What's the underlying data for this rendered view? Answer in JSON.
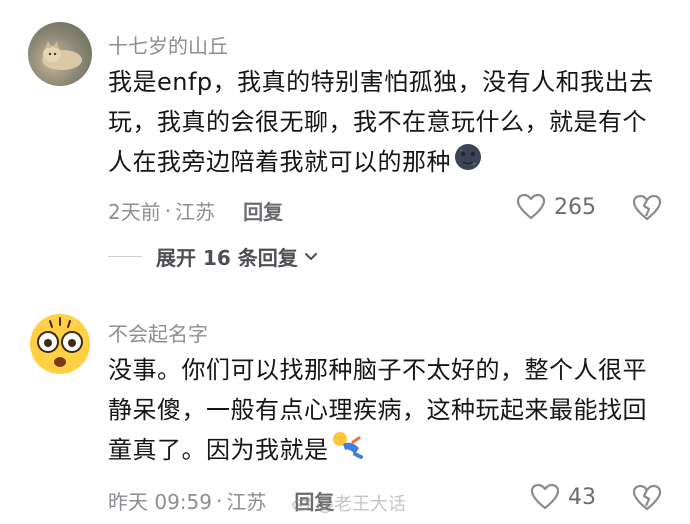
{
  "comments": [
    {
      "username": "十七岁的山丘",
      "text": "我是enfp，我真的特别害怕孤独，没有人和我出去玩，我真的会很无聊，我不在意玩什么，就是有个人在我旁边陪着我就可以的那种",
      "time": "2天前",
      "location": "江苏",
      "separator": "·",
      "reply_label": "回复",
      "likes": "265",
      "avatar_icon": "cat-photo-avatar",
      "inline_emoji": "moon-face-emoji"
    },
    {
      "username": "不会起名字",
      "text": "没事。你们可以找那种脑子不太好的，整个人很平静呆傻，一般有点心理疾病，这种玩起来最能找回童真了。因为我就是",
      "time": "昨天 09:59",
      "location": "江苏",
      "separator": "·",
      "reply_label": "回复",
      "likes": "43",
      "avatar_icon": "shocked-face-emoji-avatar",
      "inline_emoji": "rolling-person-emoji"
    }
  ],
  "expand_replies": "展开 16 条回复",
  "watermark": "@老王大话",
  "colors": {
    "meta": "#8d8d93",
    "text": "#161616",
    "reply": "#6b6b70"
  }
}
